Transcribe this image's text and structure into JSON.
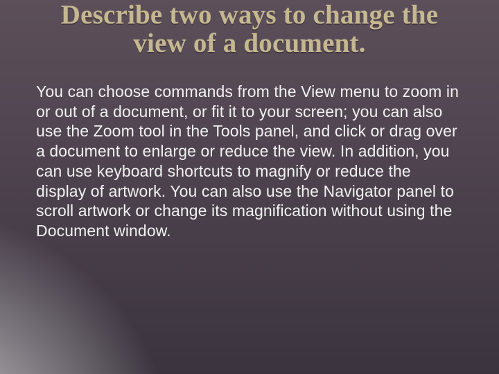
{
  "slide": {
    "title": "Describe two ways to change the view of a document.",
    "body": "You can choose commands from the View menu to zoom in or out of a document, or fit it to your screen; you can also use the Zoom tool in the Tools panel, and click or drag over a document to enlarge or reduce the view. In addition, you can use keyboard shortcuts to magnify or reduce the display of artwork. You can also use the Navigator panel to scroll artwork or change its magnification without using the Document window."
  }
}
